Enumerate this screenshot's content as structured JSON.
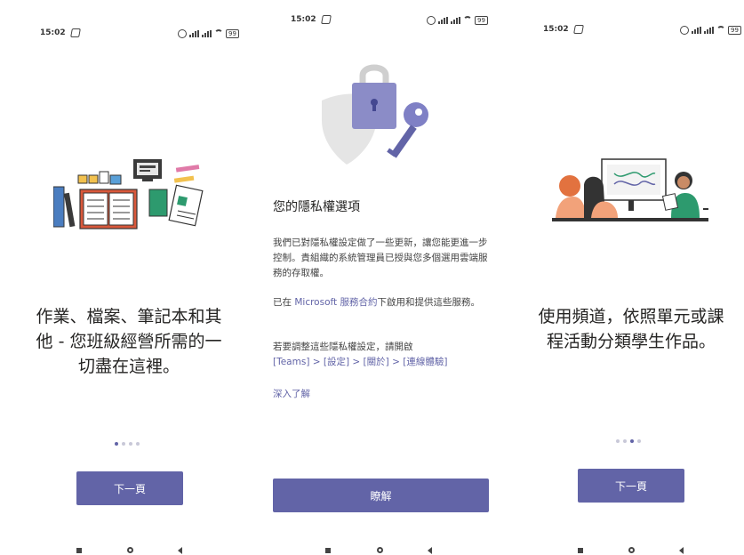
{
  "screens": [
    {
      "status": {
        "time": "15:02",
        "battery": "99"
      },
      "message": "作業、檔案、筆記本和其他 - 您班級經營所需的一切盡在這裡。",
      "next_button": "下一頁"
    },
    {
      "status": {
        "time": "15:02",
        "battery": "99"
      },
      "title": "您的隱私權選項",
      "para1": "我們已對隱私權設定做了一些更新，讓您能更進一步控制。貴組織的系統管理員已授與您多個選用雲端服務的存取權。",
      "para2_prefix": "已在 ",
      "para2_link": "Microsoft 服務合約",
      "para2_suffix": "下啟用和提供這些服務。",
      "para3_text": "若要調整這些隱私權設定，請開啟",
      "para3_path": "[Teams] > [設定] > [關於] > [連線體驗]",
      "learn_more": "深入了解",
      "ok_button": "瞭解"
    },
    {
      "status": {
        "time": "15:02",
        "battery": "99"
      },
      "message": "使用頻道，依照單元或課程活動分類學生作品。",
      "next_button": "下一頁"
    }
  ],
  "colors": {
    "accent": "#6264a7",
    "text": "#252423"
  },
  "icons": [
    "alarm-icon",
    "signal-icon",
    "wifi-icon",
    "battery-icon",
    "lock-icon",
    "key-icon",
    "shield-icon"
  ]
}
